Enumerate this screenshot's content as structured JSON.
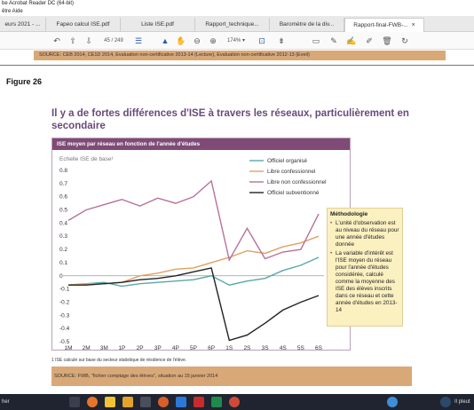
{
  "window": {
    "title": "be Acrobat Reader DC (64-bit)",
    "menu": "être  Aide"
  },
  "tabs": [
    {
      "label": "eurs 2021 - ..."
    },
    {
      "label": "Fapeo calcul ISE.pdf"
    },
    {
      "label": "Liste ISE.pdf"
    },
    {
      "label": "Rapport_technique..."
    },
    {
      "label": "Baromètre de la div..."
    },
    {
      "label": "Rapport-final-FWB-...",
      "close": "×"
    }
  ],
  "toolbar": {
    "page_current": "45",
    "page_sep": "/",
    "page_total": "249",
    "zoom": "174%"
  },
  "document": {
    "source_top": "SOURCE: CEB 2014, CE1D 2014, Evaluation non-certificative 2013-14 (Lecture), Evaluation non-certificative 2012-13 (Eveil)",
    "figure_label": "Figure 26",
    "headline": "Il y a de fortes différences d'ISE à travers les réseaux, particulièrement en secondaire",
    "footnote": "1 ISE calculé sur base du secteur statistique de résidence de l'élève.",
    "source_bottom": "SOURCE: FWB, \"fichier comptage des élèves\", situation au 15 janvier 2014",
    "method": {
      "title": "Méthodologie",
      "items": [
        "L'unité d'observation est au niveau du réseau pour une année d'études donnée",
        "La variable d'intérêt est l'ISE moyen du réseau pour l'année d'études considérée, calculé comme la moyenne des ISE des élèves inscrits dans ce réseau et cette année d'études en 2013-14"
      ]
    }
  },
  "taskbar": {
    "search": "her",
    "weather": "Il pleut"
  },
  "chart_data": {
    "type": "line",
    "title": "ISE moyen par réseau en fonction de l'année d'études",
    "ylabel": "Echelle ISE de base¹",
    "xlabel": "",
    "categories": [
      "1M",
      "2M",
      "3M",
      "1P",
      "2P",
      "3P",
      "4P",
      "5P",
      "6P",
      "1S",
      "2S",
      "3S",
      "4S",
      "5S",
      "6S"
    ],
    "ylim": [
      -0.5,
      0.8
    ],
    "yticks": [
      "0.8",
      "0.7",
      "0.6",
      "0.5",
      "0.4",
      "0.3",
      "0.2",
      "0.1",
      "0",
      "-0.1",
      "-0.2",
      "-0.3",
      "-0.4",
      "-0.5"
    ],
    "grid": false,
    "legend_position": "top-right",
    "series": [
      {
        "name": "Officiel organisé",
        "color": "#5aa7a7",
        "values": [
          -0.07,
          -0.06,
          -0.05,
          -0.08,
          -0.06,
          -0.05,
          -0.04,
          -0.03,
          0.0,
          -0.07,
          -0.04,
          -0.02,
          0.04,
          0.08,
          0.14
        ]
      },
      {
        "name": "Libre confessionnel",
        "color": "#e0a15f",
        "values": [
          -0.07,
          -0.06,
          -0.06,
          -0.05,
          0.0,
          0.02,
          0.05,
          0.06,
          0.1,
          0.14,
          0.19,
          0.17,
          0.22,
          0.25,
          0.3
        ]
      },
      {
        "name": "Libre non confessionnel",
        "color": "#b7719d",
        "values": [
          0.42,
          0.5,
          0.54,
          0.58,
          0.53,
          0.59,
          0.55,
          0.6,
          0.72,
          0.12,
          0.36,
          0.13,
          0.18,
          0.2,
          0.47
        ]
      },
      {
        "name": "Officiel subventionné",
        "color": "#222222",
        "values": [
          -0.07,
          -0.07,
          -0.06,
          -0.05,
          -0.03,
          -0.02,
          0.0,
          0.03,
          0.06,
          -0.49,
          -0.45,
          -0.36,
          -0.26,
          -0.2,
          -0.15
        ]
      }
    ]
  }
}
